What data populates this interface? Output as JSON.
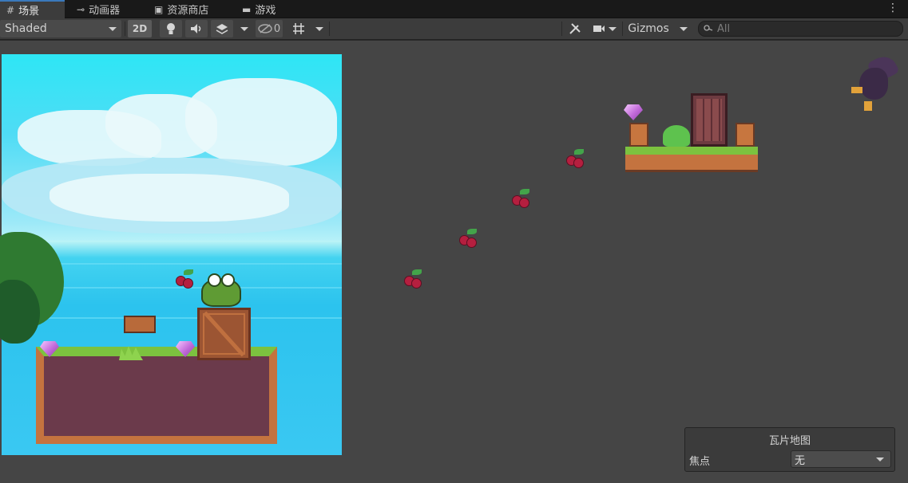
{
  "tabs": [
    {
      "label": "场景",
      "icon": "grid-icon",
      "active": true
    },
    {
      "label": "动画器",
      "icon": "animator-icon",
      "active": false
    },
    {
      "label": "资源商店",
      "icon": "bag-icon",
      "active": false
    },
    {
      "label": "游戏",
      "icon": "gamepad-icon",
      "active": false
    }
  ],
  "toolbar": {
    "shading_mode": "Shaded",
    "toggle_2d": "2D",
    "hidden_count": "0",
    "gizmos": "Gizmos",
    "search_placeholder": "All"
  },
  "tilemap_overlay": {
    "title": "瓦片地图",
    "focus_label": "焦点",
    "focus_value": "无"
  },
  "colors": {
    "scene_bg": "#454545",
    "tab_accent": "#3a79bb"
  }
}
